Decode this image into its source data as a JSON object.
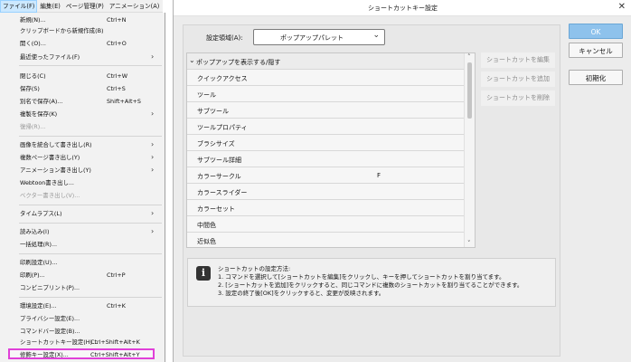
{
  "menubar": {
    "items": [
      "ファイル(F)",
      "編集(E)",
      "ページ管理(P)",
      "アニメーション(A)"
    ]
  },
  "file_menu": {
    "items": [
      {
        "label": "新規(N)...",
        "shortcut": "Ctrl+N"
      },
      {
        "label": "クリップボードから新規作成(B)",
        "shortcut": ""
      },
      {
        "label": "開く(O)...",
        "shortcut": "Ctrl+O"
      },
      {
        "label": "最近使ったファイル(F)",
        "shortcut": ""
      },
      {
        "label": "閉じる(C)",
        "shortcut": "Ctrl+W"
      },
      {
        "label": "保存(S)",
        "shortcut": "Ctrl+S"
      },
      {
        "label": "別名で保存(A)...",
        "shortcut": "Shift+Alt+S"
      },
      {
        "label": "複製を保存(K)",
        "shortcut": ""
      },
      {
        "label": "復帰(R)...",
        "shortcut": ""
      },
      {
        "label": "画像を統合して書き出し(R)",
        "shortcut": ""
      },
      {
        "label": "複数ページ書き出し(Y)",
        "shortcut": ""
      },
      {
        "label": "アニメーション書き出し(Y)",
        "shortcut": ""
      },
      {
        "label": "Webtoon書き出し...",
        "shortcut": ""
      },
      {
        "label": "ベクター書き出し(V)...",
        "shortcut": ""
      },
      {
        "label": "タイムラプス(L)",
        "shortcut": ""
      },
      {
        "label": "読み込み(I)",
        "shortcut": ""
      },
      {
        "label": "一括処理(R)...",
        "shortcut": ""
      },
      {
        "label": "印刷設定(U)...",
        "shortcut": ""
      },
      {
        "label": "印刷(P)...",
        "shortcut": "Ctrl+P"
      },
      {
        "label": "コンビニプリント(P)...",
        "shortcut": ""
      },
      {
        "label": "環境設定(E)...",
        "shortcut": "Ctrl+K"
      },
      {
        "label": "プライバシー設定(E)...",
        "shortcut": ""
      },
      {
        "label": "コマンドバー設定(B)...",
        "shortcut": ""
      },
      {
        "label": "ショートカットキー設定(H)...",
        "shortcut": "Ctrl+Shift+Alt+K"
      },
      {
        "label": "修飾キー設定(X)...",
        "shortcut": "Ctrl+Shift+Alt+Y"
      }
    ]
  },
  "dialog": {
    "title": "ショートカットキー設定",
    "area_label": "設定領域(A):",
    "area_value": "ポップアップパレット",
    "tree": {
      "group": "ポップアップを表示する/隠す",
      "rows": [
        {
          "name": "クイックアクセス",
          "key": ""
        },
        {
          "name": "ツール",
          "key": ""
        },
        {
          "name": "サブツール",
          "key": ""
        },
        {
          "name": "ツールプロパティ",
          "key": ""
        },
        {
          "name": "ブラシサイズ",
          "key": ""
        },
        {
          "name": "サブツール詳細",
          "key": ""
        },
        {
          "name": "カラーサークル",
          "key": "F"
        },
        {
          "name": "カラースライダー",
          "key": ""
        },
        {
          "name": "カラーセット",
          "key": ""
        },
        {
          "name": "中間色",
          "key": ""
        },
        {
          "name": "近似色",
          "key": ""
        }
      ]
    },
    "side_buttons": {
      "edit": "ショートカットを編集",
      "add": "ショートカットを追加",
      "delete": "ショートカットを削除"
    },
    "info": {
      "heading": "ショートカットの設定方法:",
      "lines": [
        "1. コマンドを選択して[ショートカットを編集]をクリックし、キーを押してショートカットを割り当てます。",
        "2. [ショートカットを追加]をクリックすると、同じコマンドに複数のショートカットを割り当てることができます。",
        "3. 設定の終了後[OK]をクリックすると、変更が反映されます。"
      ]
    },
    "buttons": {
      "ok": "OK",
      "cancel": "キャンセル",
      "reset": "初期化"
    }
  },
  "colors": {
    "highlight_box": "#e040d8",
    "ok_button": "#8ec2ec",
    "menu_active": "#cce8ff"
  }
}
